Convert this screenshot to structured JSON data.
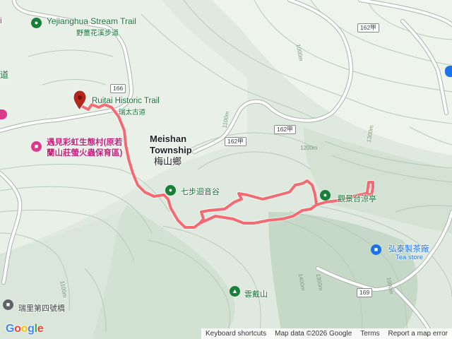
{
  "map": {
    "colors": {
      "terrain_base": "#dfe9df",
      "terrain_shade": "#c5d7c7",
      "contour": "#b4c9b7",
      "road": "#ffffff",
      "road_edge": "#a9b5ab",
      "trail_route": "#f26b72"
    },
    "places": {
      "yejianghua": {
        "name": "Yejianghua Stream Trail",
        "name_zh": "野薑花溪步道",
        "icon": "hiker-icon"
      },
      "ruitai": {
        "name": "Ruitai Historic Trail",
        "name_zh": "瑞太古道",
        "icon": "hiker-icon"
      },
      "rainbow": {
        "line1": "遇見彩虹生態村(原若",
        "line2": "蘭山莊螢火蟲保育區)",
        "icon": "building-icon"
      },
      "meishan": {
        "name_line1": "Meishan",
        "name_line2": "Township",
        "name_zh": "梅山鄉"
      },
      "qibu": {
        "name": "七步迴音谷",
        "icon": "hiker-icon"
      },
      "pavilion": {
        "name": "觀景台涼亭",
        "icon": "hiker-icon"
      },
      "tea": {
        "name": "弘泰製茶廠",
        "name_en": "Tea store",
        "icon": "shopping-bag-icon"
      },
      "yundai": {
        "name": "雲戴山",
        "icon": "mountain-icon"
      },
      "bridge": {
        "name": "瑞里第四號橋",
        "icon": "bridge-icon"
      },
      "edge_left": {
        "name": "道"
      },
      "edge_top": {
        "name": "i"
      }
    },
    "roads": {
      "r166": "166",
      "r162a_1": "162甲",
      "r162a_2": "162甲",
      "r162a_3": "162甲",
      "r169": "169"
    },
    "elevations": {
      "e1": "1000m",
      "e2": "1100m",
      "e3": "1200m",
      "e4": "1300m",
      "e5": "1100m",
      "e6": "1400m",
      "e7": "1300m",
      "e8": "1000m"
    },
    "google_logo": "Google",
    "attribution": {
      "shortcuts": "Keyboard shortcuts",
      "map_data": "Map data ©2026 Google",
      "terms": "Terms",
      "report": "Report a map error"
    }
  }
}
